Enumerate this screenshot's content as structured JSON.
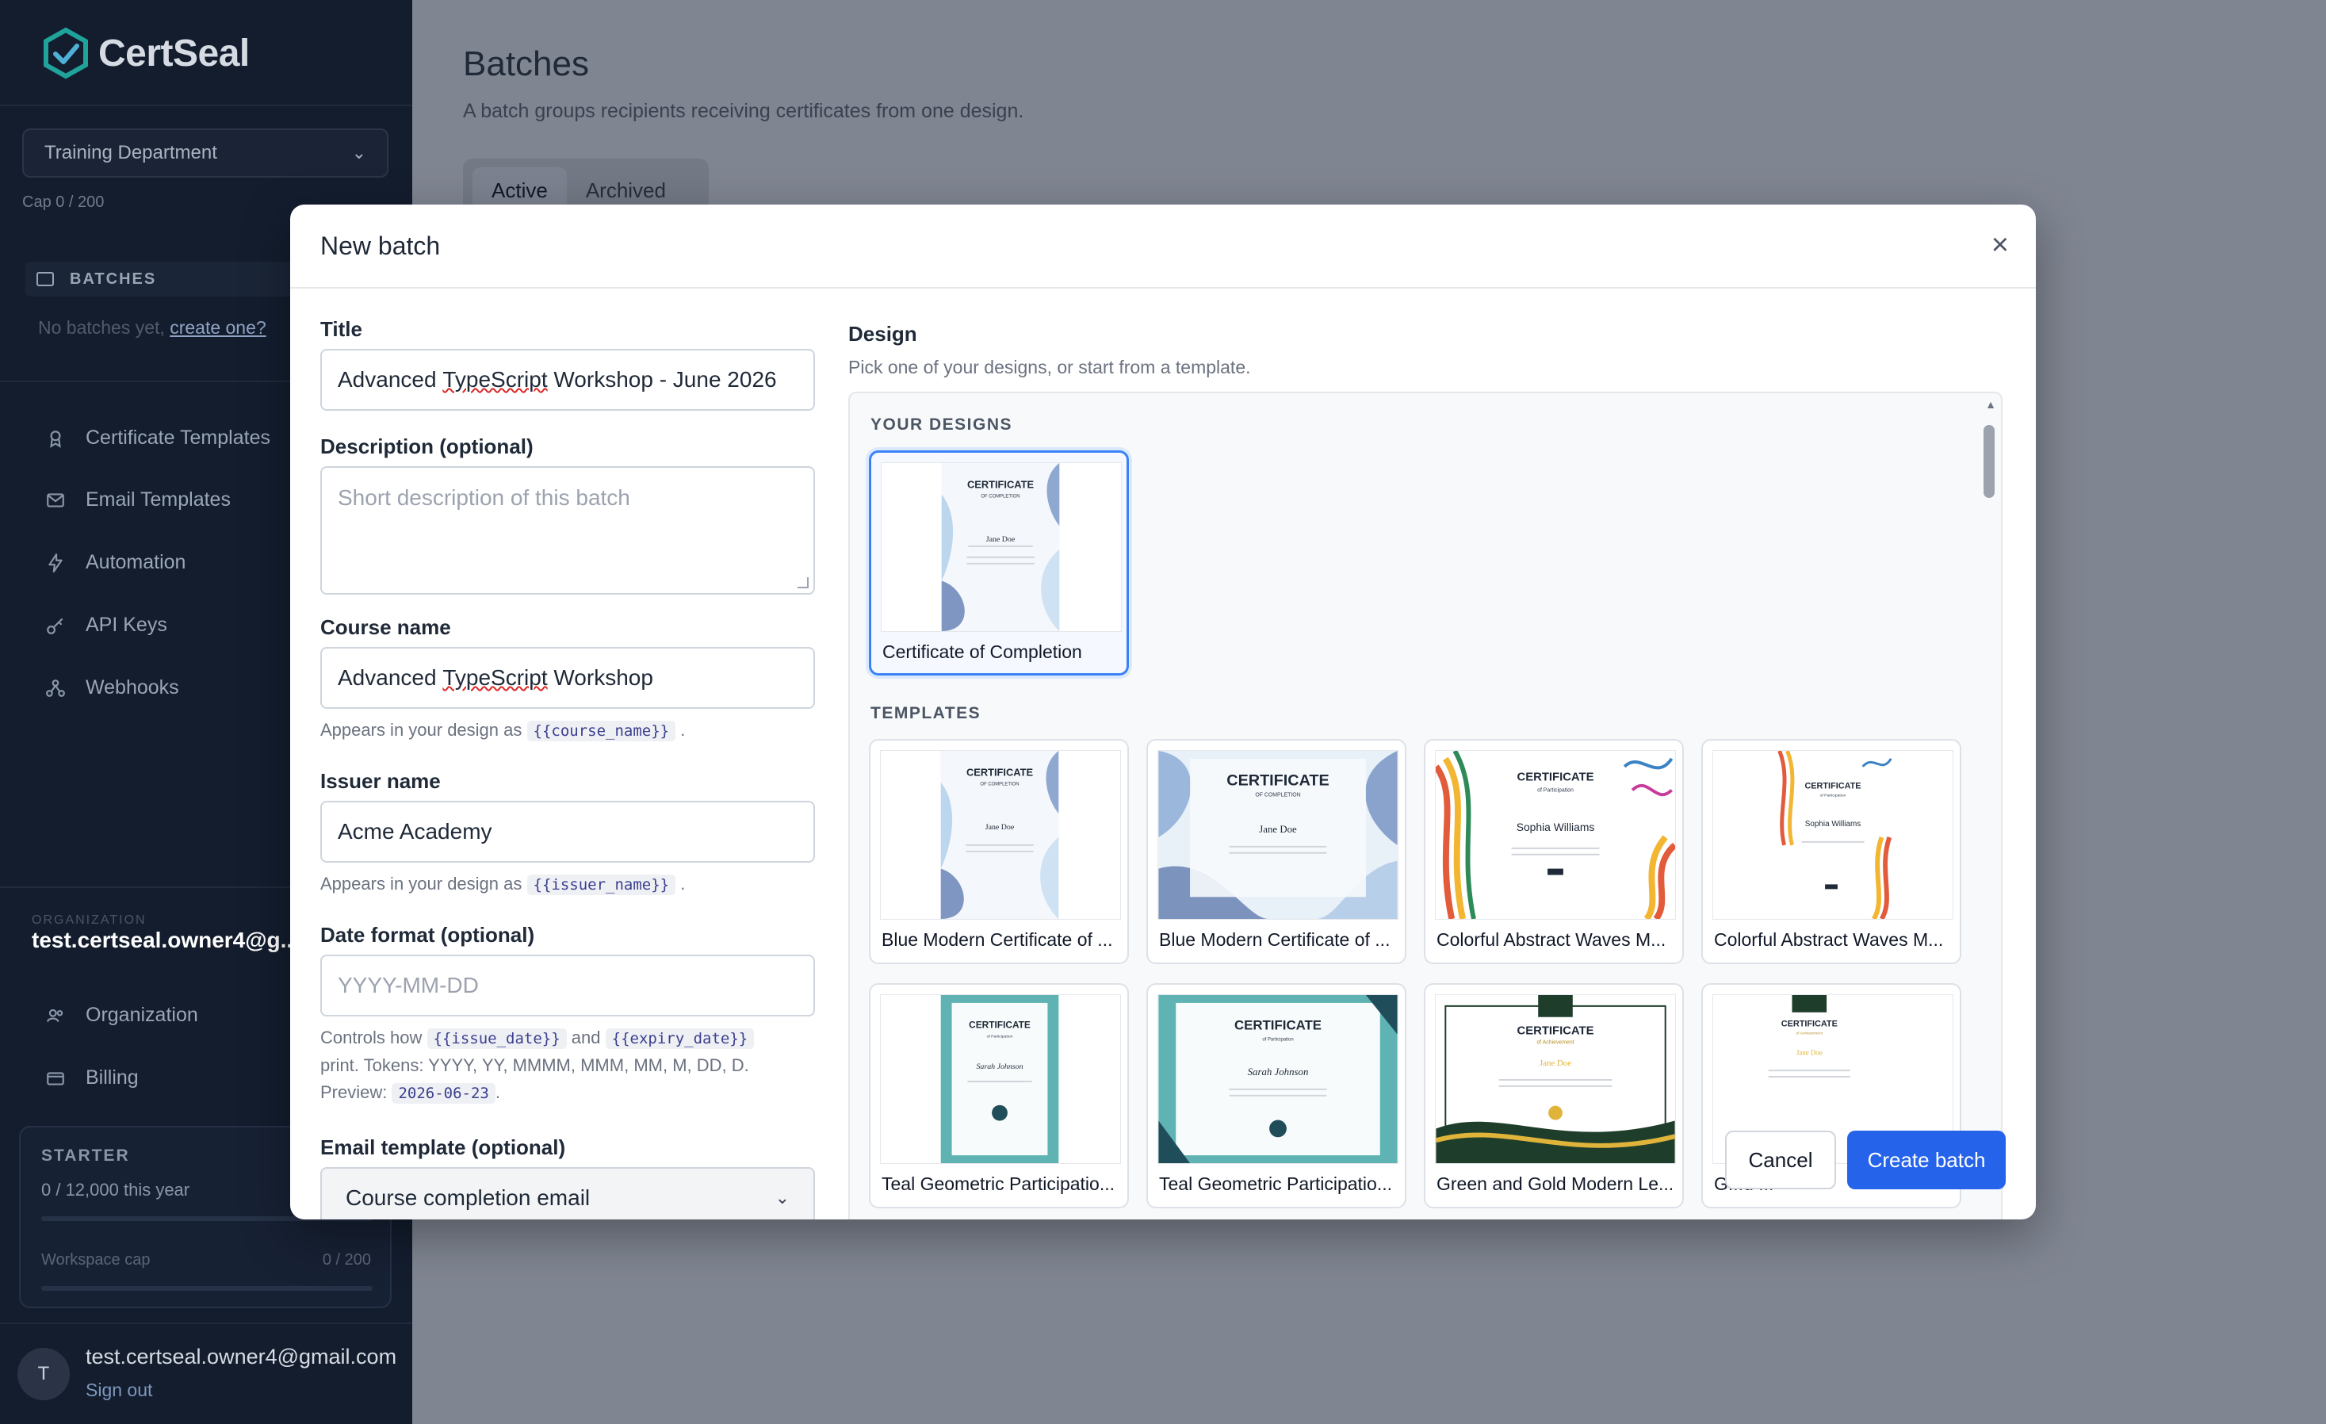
{
  "brand": {
    "name": "CertSeal",
    "accent": "#2563eb"
  },
  "sidebar": {
    "department": "Training Department",
    "cap": "Cap 0 / 200",
    "batches_heading": "BATCHES",
    "no_batches_text": "No batches yet,",
    "create_link": "create one?",
    "nav": [
      {
        "label": "Certificate Templates",
        "icon": "certificate-icon"
      },
      {
        "label": "Email Templates",
        "icon": "mail-icon"
      },
      {
        "label": "Automation",
        "icon": "bolt-icon"
      },
      {
        "label": "API Keys",
        "icon": "key-icon"
      },
      {
        "label": "Webhooks",
        "icon": "webhook-icon"
      }
    ],
    "organization_label": "ORGANIZATION",
    "organization_email": "test.certseal.owner4@g...",
    "org_nav": [
      {
        "label": "Organization",
        "icon": "users-icon"
      },
      {
        "label": "Billing",
        "icon": "card-icon"
      }
    ],
    "plan": {
      "name": "STARTER",
      "usage": "0 / 12,000 this year",
      "usage_fraction": 0,
      "cap_label": "Workspace cap",
      "cap_value": "0 / 200",
      "cap_fraction": 0
    },
    "user": {
      "initial": "T",
      "email": "test.certseal.owner4@gmail.com",
      "sign_out": "Sign out"
    }
  },
  "main": {
    "title": "Batches",
    "subtitle": "A batch groups recipients receiving certificates from one design.",
    "tabs": [
      "Active",
      "Archived"
    ]
  },
  "modal": {
    "title": "New batch",
    "close": "×",
    "form": {
      "title_label": "Title",
      "title_value_a": "Advanced ",
      "title_value_b": "TypeScript",
      "title_value_c": " Workshop - June 2026",
      "description_label": "Description (optional)",
      "description_placeholder": "Short description of this batch",
      "course_label": "Course name",
      "course_value_a": "Advanced ",
      "course_value_b": "TypeScript",
      "course_value_c": " Workshop",
      "course_help": "Appears in your design as",
      "course_token": "{{course_name}}",
      "issuer_label": "Issuer name",
      "issuer_value": "Acme Academy",
      "issuer_help": "Appears in your design as",
      "issuer_token": "{{issuer_name}}",
      "date_label": "Date format (optional)",
      "date_placeholder": "YYYY-MM-DD",
      "date_help_1": "Controls how",
      "date_token_1": "{{issue_date}}",
      "date_help_and": "and",
      "date_token_2": "{{expiry_date}}",
      "date_help_2": "print. Tokens: YYYY, YY, MMMM, MMM, MM, M, DD, D.",
      "date_help_preview": "Preview:",
      "date_preview": "2026-06-23",
      "email_label": "Email template (optional)",
      "email_value": "Course completion email"
    },
    "design": {
      "title": "Design",
      "subtitle": "Pick one of your designs, or start from a template.",
      "your_designs_heading": "YOUR DESIGNS",
      "your_designs": [
        {
          "name": "Certificate of Completion",
          "selected": true
        }
      ],
      "templates_heading": "TEMPLATES",
      "templates": [
        {
          "name": "Blue Modern Certificate of ..."
        },
        {
          "name": "Blue Modern Certificate of ..."
        },
        {
          "name": "Colorful Abstract Waves M..."
        },
        {
          "name": "Colorful Abstract Waves M..."
        },
        {
          "name": "Teal Geometric Participatio..."
        },
        {
          "name": "Teal Geometric Participatio..."
        },
        {
          "name": "Green and Gold Modern Le..."
        },
        {
          "name": "G...d ..."
        }
      ],
      "thumb_text": {
        "certificate": "CERTIFICATE",
        "of_completion": "OF COMPLETION",
        "of_participation": "of Participation",
        "of_achievement": "of Achievement",
        "jane": "Jane Doe",
        "sophia": "Sophia Williams",
        "sarah": "Sarah Johnson"
      }
    },
    "buttons": {
      "cancel": "Cancel",
      "create": "Create batch"
    }
  }
}
